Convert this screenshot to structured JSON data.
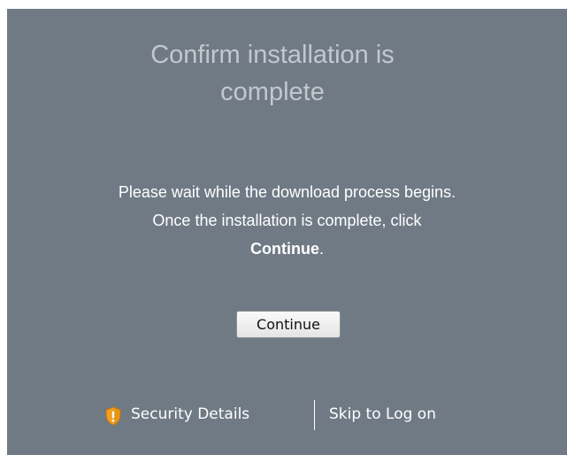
{
  "dialog": {
    "title_line1": "Confirm installation is",
    "title_line2": "complete",
    "message_line1": "Please wait while the download process begins.",
    "message_line2": "Once the installation is complete, click",
    "message_bold": "Continue",
    "message_end": "."
  },
  "actions": {
    "continue_label": "Continue"
  },
  "footer": {
    "security_label": "Security Details",
    "security_icon": "shield-warning-icon",
    "skip_label": "Skip to Log on"
  },
  "colors": {
    "panel_background": "#6f7a85",
    "title_text": "#c3c8cd",
    "shield_orange": "#f0a020"
  }
}
